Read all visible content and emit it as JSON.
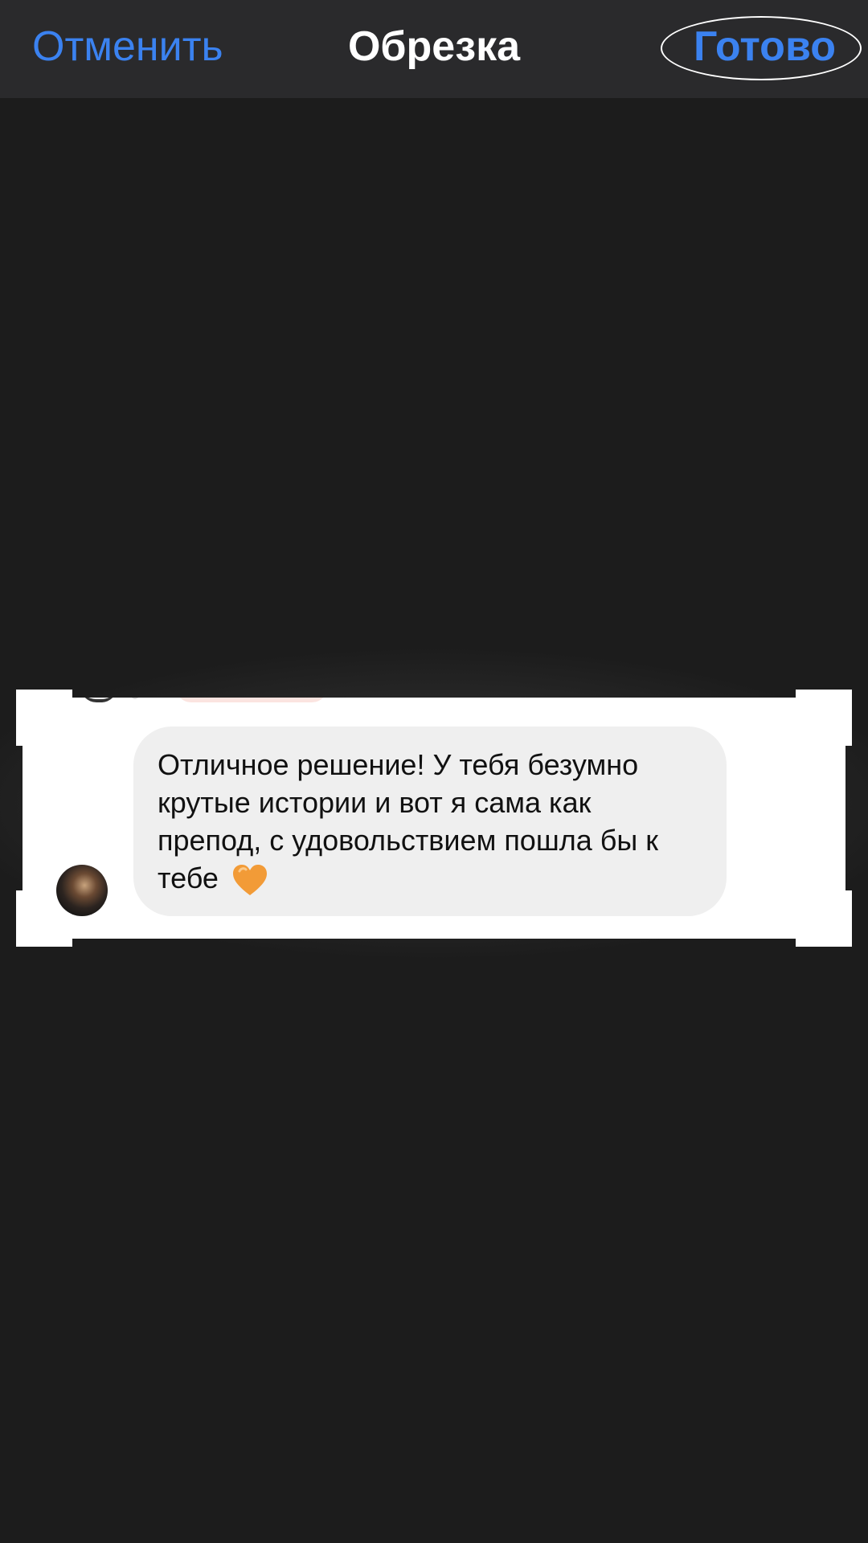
{
  "header": {
    "cancel_label": "Отменить",
    "title": "Обрезка",
    "done_label": "Готово"
  },
  "message": {
    "lines": [
      "Отличное решение! У тебя безумно",
      "крутые истории и вот я сама как",
      "препод, с удовольствием пошла бы к",
      "тебе"
    ],
    "emoji": "orange-heart"
  },
  "colors": {
    "accent": "#3b82f0",
    "header_bg": "#2a2a2c",
    "canvas_bg": "#1c1c1c",
    "bubble_bg": "#efefef",
    "heart": "#f29b37"
  }
}
